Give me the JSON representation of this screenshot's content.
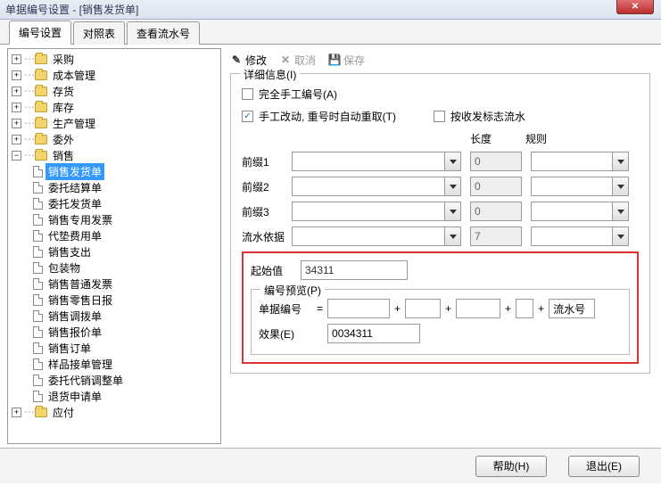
{
  "window": {
    "title": "单据编号设置 - [销售发货单]"
  },
  "tabs": {
    "t1": "编号设置",
    "t2": "对照表",
    "t3": "查看流水号"
  },
  "tree": {
    "n0": "采购",
    "n1": "成本管理",
    "n2": "存货",
    "n3": "库存",
    "n4": "生产管理",
    "n5": "委外",
    "n6": "销售",
    "c0": "销售发货单",
    "c1": "委托结算单",
    "c2": "委托发货单",
    "c3": "销售专用发票",
    "c4": "代垫费用单",
    "c5": "销售支出",
    "c6": "包装物",
    "c7": "销售普通发票",
    "c8": "销售零售日报",
    "c9": "销售调拨单",
    "c10": "销售报价单",
    "c11": "销售订单",
    "c12": "样品接单管理",
    "c13": "委托代销调整单",
    "c14": "退货申请单",
    "n7": "应付"
  },
  "toolbar": {
    "edit": "修改",
    "cancel": "取消",
    "save": "保存"
  },
  "legend": {
    "detail": "详细信息(I)",
    "preview": "编号预览(P)"
  },
  "check": {
    "manual": "完全手工编号(A)",
    "auto": "手工改动, 重号时自动重取(T)",
    "byflag": "按收发标志流水"
  },
  "head": {
    "len": "长度",
    "rule": "规则"
  },
  "labels": {
    "p1": "前缀1",
    "p2": "前缀2",
    "p3": "前缀3",
    "basis": "流水依据",
    "start": "起始值",
    "docnum": "单据编号",
    "result": "效果(E)",
    "serial": "流水号"
  },
  "values": {
    "p1len": "0",
    "p2len": "0",
    "p3len": "0",
    "basislen": "7",
    "start": "34311",
    "result": "0034311"
  },
  "footer": {
    "help": "帮助(H)",
    "exit": "退出(E)"
  }
}
